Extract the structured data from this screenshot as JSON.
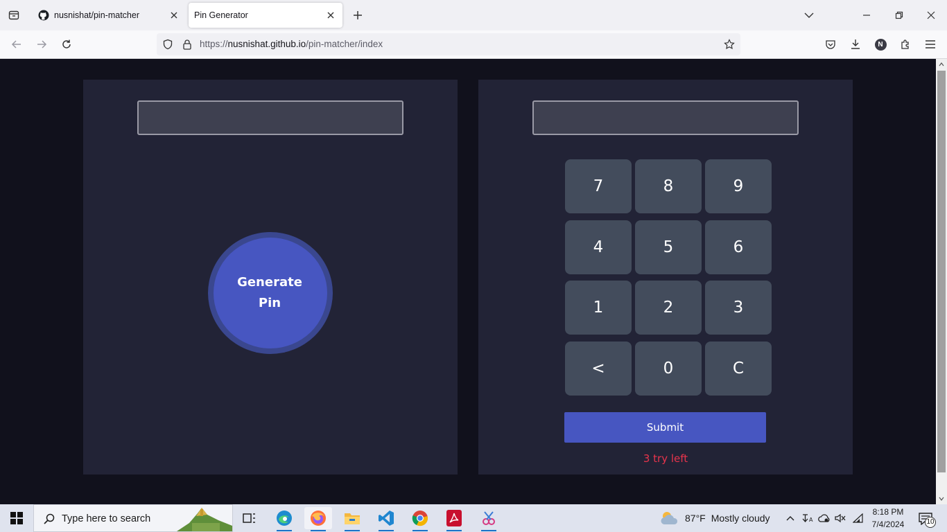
{
  "browser": {
    "tabs": [
      {
        "title": "nusnishat/pin-matcher",
        "favicon": "github-icon",
        "active": false
      },
      {
        "title": "Pin Generator",
        "favicon": "",
        "active": true
      }
    ],
    "url": {
      "scheme": "https://",
      "host": "nusnishat.github.io",
      "path": "/pin-matcher/index"
    },
    "profile_initial": "N"
  },
  "app": {
    "generator": {
      "display_value": "",
      "button_line1": "Generate",
      "button_line2": "Pin"
    },
    "matcher": {
      "display_value": "",
      "keys": [
        "7",
        "8",
        "9",
        "4",
        "5",
        "6",
        "1",
        "2",
        "3",
        "<",
        "0",
        "C"
      ],
      "submit_label": "Submit",
      "tries_text": "3 try left"
    },
    "colors": {
      "panel": "#222336",
      "accent": "#4756c1",
      "key": "#434c5c",
      "error": "#e8344c"
    }
  },
  "taskbar": {
    "search_placeholder": "Type here to search",
    "weather_temp": "87°F",
    "weather_desc": "Mostly cloudy",
    "time": "8:18 PM",
    "date": "7/4/2024",
    "notification_count": "10"
  }
}
